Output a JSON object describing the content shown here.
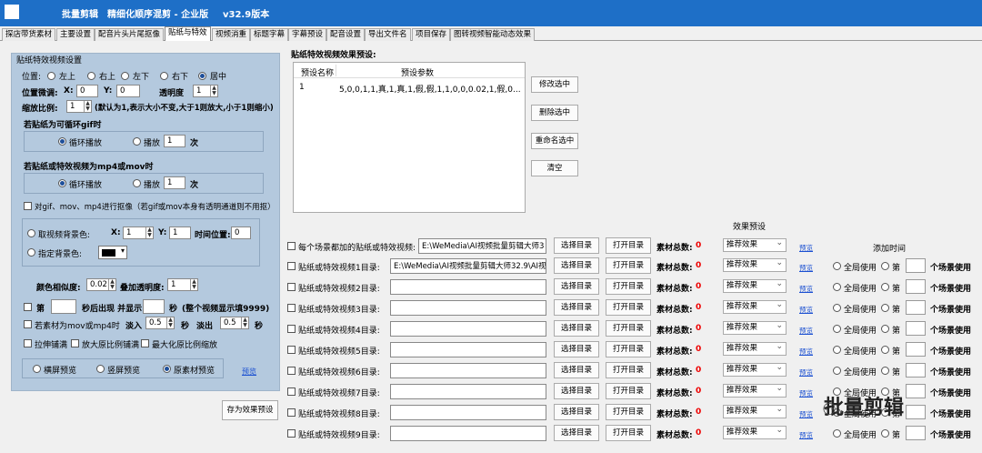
{
  "title": {
    "app": "批量剪辑",
    "edition": "精细化顺序混剪 - 企业版",
    "version": "v32.9版本"
  },
  "tabs": [
    "探店带货素材",
    "主要设置",
    "配音片头片尾抠像",
    "贴纸与特效",
    "视频消重",
    "标题字幕",
    "字幕预设",
    "配音设置",
    "导出文件名",
    "项目保存",
    "图转视频智能动态效果"
  ],
  "left": {
    "group_title": "贴纸特效视频设置",
    "position_label": "位置:",
    "positions": [
      "左上",
      "右上",
      "左下",
      "右下",
      "居中"
    ],
    "fine_label": "位置微调:",
    "x_label": "X:",
    "x_value": "0",
    "y_label": "Y:",
    "y_value": "0",
    "opacity_label": "透明度",
    "opacity_value": "1",
    "scale_label": "缩放比例:",
    "scale_value": "1",
    "scale_note": "(默认为1,表示大小不变,大于1则放大,小于1则缩小)",
    "gif_title": "若贴纸为可循环gif时",
    "loop_label": "循环播放",
    "play_label": "播放",
    "play_gif_value": "1",
    "times_label": "次",
    "mp4_title": "若贴纸或特效视频为mp4或mov时",
    "play_mp4_value": "1",
    "keying_label": "对gif、mov、mp4进行抠像（若gif或mov本身有透明通道则不用抠）",
    "bgcolor_pick_label": "取视频背景色:",
    "pick_x": "1",
    "pick_y": "1",
    "time_pos_label": "时间位置:",
    "time_pos_value": "0",
    "bgcolor_set_label": "指定背景色:",
    "color_sim_label": "颜色相似度:",
    "color_sim_value": "0.02",
    "add_opacity_label": "叠加透明度:",
    "add_opacity_value": "1",
    "nth_label": "第",
    "appear_label": "秒后出现 并显示",
    "sec_label": "秒",
    "whole_note": "(整个视频显示填9999)",
    "fade_label": "若素材为mov或mp4时",
    "fade_in_label": "淡入",
    "fade_in_value": "0.5",
    "fade_out_label": "淡出",
    "fade_out_value": "0.5",
    "stretch_label": "拉伸铺满",
    "enlarge_label": "放大原比例铺满",
    "max_label": "最大化原比例缩放",
    "preview_options": [
      "横屏预览",
      "竖屏预览",
      "原素材预览"
    ],
    "preview_link": "预览",
    "save_preset": "存为效果预设"
  },
  "preset": {
    "title": "贴纸特效视频效果预设:",
    "columns": [
      "预设名称",
      "预设参数"
    ],
    "rows": [
      {
        "name": "1",
        "params": "5,0,0,1,1,真,1,真,1,假,假,1,1,0,0,0.02,1,假,0..."
      }
    ],
    "buttons": [
      "修改选中",
      "删除选中",
      "重命名选中",
      "清空"
    ]
  },
  "table": {
    "effect_header": "效果预设",
    "add_time_header": "添加时间",
    "choose": "选择目录",
    "open": "打开目录",
    "count_label": "素材总数:",
    "rows": [
      {
        "label": "每个场景都加的贴纸或特效视频:",
        "path": "E:\\WeMedia\\AI视频批量剪辑大师3",
        "count": "0",
        "effect": "推荐效果",
        "link": "预览",
        "global": "",
        "nth": "",
        "use": ""
      },
      {
        "label": "贴纸或特效视频1目录:",
        "path": "E:\\WeMedia\\AI视频批量剪辑大师32.9\\AI视",
        "count": "0",
        "effect": "推荐效果",
        "link": "预览",
        "global": "全局使用",
        "nth": "第",
        "use": "个场景使用"
      },
      {
        "label": "贴纸或特效视频2目录:",
        "path": "",
        "count": "0",
        "effect": "推荐效果",
        "link": "预览",
        "global": "全局使用",
        "nth": "第",
        "use": "个场景使用"
      },
      {
        "label": "贴纸或特效视频3目录:",
        "path": "",
        "count": "0",
        "effect": "推荐效果",
        "link": "预览",
        "global": "全局使用",
        "nth": "第",
        "use": "个场景使用"
      },
      {
        "label": "贴纸或特效视频4目录:",
        "path": "",
        "count": "0",
        "effect": "推荐效果",
        "link": "预览",
        "global": "全局使用",
        "nth": "第",
        "use": "个场景使用"
      },
      {
        "label": "贴纸或特效视频5目录:",
        "path": "",
        "count": "0",
        "effect": "推荐效果",
        "link": "预览",
        "global": "全局使用",
        "nth": "第",
        "use": "个场景使用"
      },
      {
        "label": "贴纸或特效视频6目录:",
        "path": "",
        "count": "0",
        "effect": "推荐效果",
        "link": "预览",
        "global": "全局使用",
        "nth": "第",
        "use": "个场景使用"
      },
      {
        "label": "贴纸或特效视频7目录:",
        "path": "",
        "count": "0",
        "effect": "推荐效果",
        "link": "预览",
        "global": "全局使用",
        "nth": "第",
        "use": "个场景使用"
      },
      {
        "label": "贴纸或特效视频8目录:",
        "path": "",
        "count": "0",
        "effect": "推荐效果",
        "link": "预览",
        "global": "全局使用",
        "nth": "第",
        "use": "个场景使用"
      },
      {
        "label": "贴纸或特效视频9目录:",
        "path": "",
        "count": "0",
        "effect": "推荐效果",
        "link": "预览",
        "global": "全局使用",
        "nth": "第",
        "use": "个场景使用"
      }
    ]
  },
  "watermark": "批量剪辑",
  "colors": {
    "titlebar": "#1e6fc7",
    "panel": "#b4c9de",
    "count": "#e00000",
    "link": "#1a4fd1"
  }
}
